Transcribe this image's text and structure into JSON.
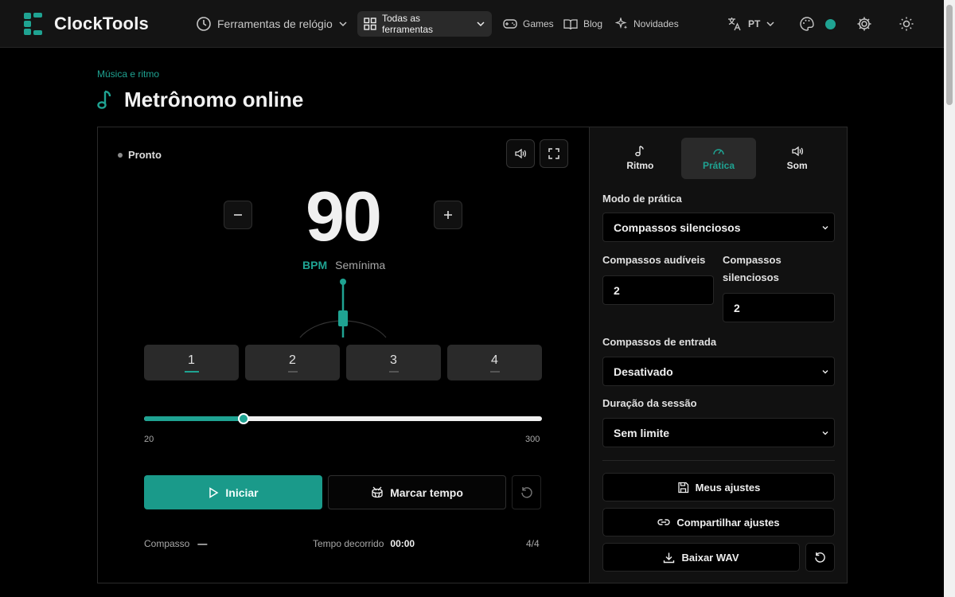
{
  "app": {
    "name": "ClockTools"
  },
  "nav": {
    "clock_tools": "Ferramentas de relógio",
    "all_tools": "Todas as ferramentas",
    "games": "Games",
    "blog": "Blog",
    "news": "Novidades",
    "lang": "PT"
  },
  "colors": {
    "accent": "#1fa392",
    "bg": "#000000",
    "surface": "#141414"
  },
  "page": {
    "breadcrumb": "Música e ritmo",
    "title": "Metrônomo online"
  },
  "metronome": {
    "status": "Pronto",
    "bpm": "90",
    "bpm_unit": "BPM",
    "note_value": "Semínima",
    "beats": [
      "1",
      "2",
      "3",
      "4"
    ],
    "active_beat": 1,
    "range_min": "20",
    "range_max": "300",
    "start_label": "Iniciar",
    "tap_label": "Marcar tempo",
    "measure_label": "Compasso",
    "measure_value": "—",
    "elapsed_label": "Tempo decorrido",
    "elapsed_value": "00:00",
    "time_signature": "4/4"
  },
  "settings": {
    "tabs": [
      "Ritmo",
      "Prática",
      "Som"
    ],
    "active_tab": "Prática",
    "practice_mode_label": "Modo de prática",
    "practice_mode_value": "Compassos silenciosos",
    "audible_bars_label": "Compassos audíveis",
    "audible_bars_value": "2",
    "silent_bars_label_1": "Compassos",
    "silent_bars_label_2": "silenciosos",
    "silent_bars_value": "2",
    "count_in_label": "Compassos de entrada",
    "count_in_value": "Desativado",
    "session_label": "Duração da sessão",
    "session_value": "Sem limite",
    "my_settings": "Meus ajustes",
    "share_settings": "Compartilhar ajustes",
    "download_wav": "Baixar WAV"
  }
}
